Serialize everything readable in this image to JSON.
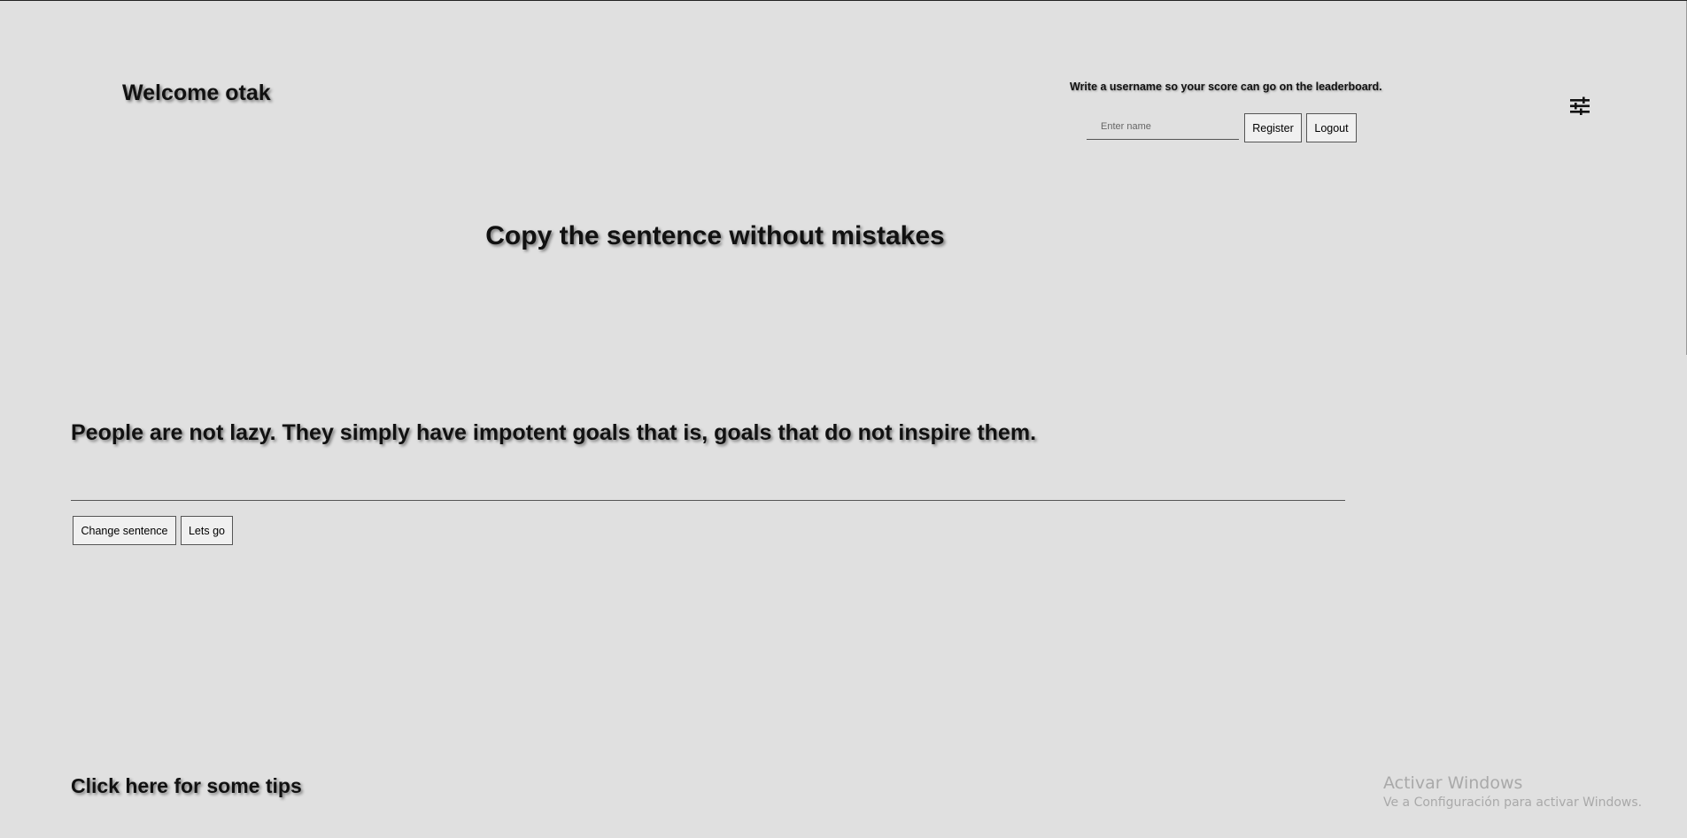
{
  "header": {
    "welcome": "Welcome otak",
    "register_hint": "Write a username so your score can go on the leaderboard.",
    "name_placeholder": "Enter name",
    "register_label": "Register",
    "logout_label": "Logout",
    "settings_icon": "sliders-icon"
  },
  "main": {
    "title": "Copy the sentence without mistakes",
    "sentence": "People are not lazy. They simply have impotent goals that is, goals that do not inspire them.",
    "answer_value": "",
    "change_label": "Change sentence",
    "go_label": "Lets go"
  },
  "footer": {
    "tips_label": "Click here for some tips"
  },
  "watermark": {
    "title": "Activar Windows",
    "subtitle": "Ve a Configuración para activar Windows."
  },
  "colors": {
    "background": "#e0e0e0",
    "text": "#111111",
    "watermark": "#a9a9a9"
  }
}
